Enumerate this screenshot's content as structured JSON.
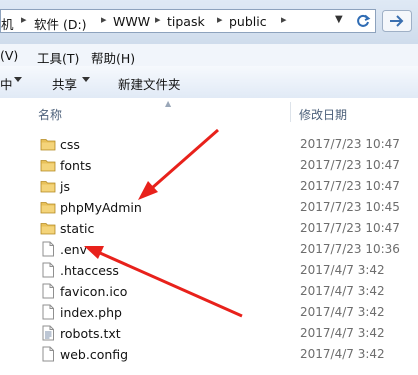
{
  "address_bar": {
    "crumbs": [
      "机",
      "软件 (D:)",
      "WWW",
      "tipask",
      "public"
    ]
  },
  "menu": {
    "items": [
      "(V)",
      "工具(T)",
      "帮助(H)"
    ]
  },
  "toolbar": {
    "partial_label": "中",
    "share_label": "共享",
    "new_folder_label": "新建文件夹"
  },
  "columns": {
    "name": "名称",
    "date_modified": "修改日期"
  },
  "files": [
    {
      "name": "css",
      "date": "2017/7/23 10:47",
      "type": "folder"
    },
    {
      "name": "fonts",
      "date": "2017/7/23 10:47",
      "type": "folder"
    },
    {
      "name": "js",
      "date": "2017/7/23 10:47",
      "type": "folder"
    },
    {
      "name": "phpMyAdmin",
      "date": "2017/7/23 10:45",
      "type": "folder"
    },
    {
      "name": "static",
      "date": "2017/7/23 10:47",
      "type": "folder"
    },
    {
      "name": ".env",
      "date": "2017/7/23 10:36",
      "type": "file"
    },
    {
      "name": ".htaccess",
      "date": "2017/4/7 3:42",
      "type": "file"
    },
    {
      "name": "favicon.ico",
      "date": "2017/4/7 3:42",
      "type": "file"
    },
    {
      "name": "index.php",
      "date": "2017/4/7 3:42",
      "type": "file"
    },
    {
      "name": "robots.txt",
      "date": "2017/4/7 3:42",
      "type": "text-file"
    },
    {
      "name": "web.config",
      "date": "2017/4/7 3:42",
      "type": "file"
    }
  ],
  "colors": {
    "annotation_arrow": "#e8211b",
    "folder": "#e8c15a",
    "date_text": "#6d6d6d"
  },
  "icons": {
    "folder": "folder-icon",
    "file": "file-icon",
    "text_file": "text-file-icon",
    "refresh": "refresh-icon",
    "forward": "forward-icon"
  }
}
